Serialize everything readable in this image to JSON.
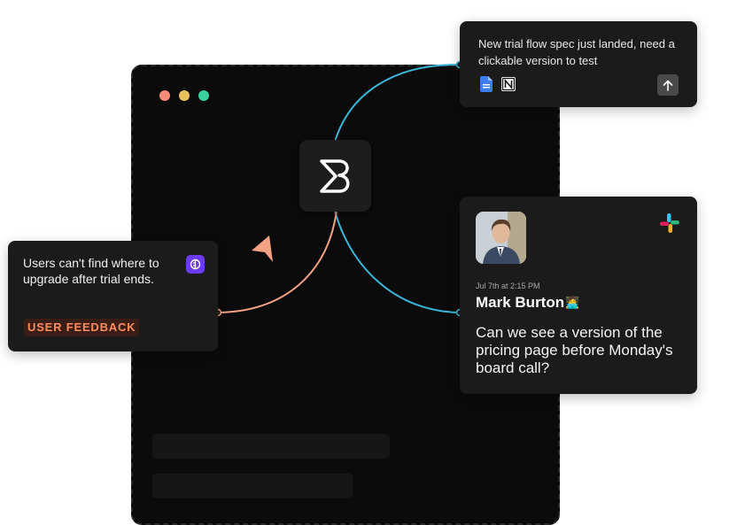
{
  "window": {
    "dot_colors": [
      "#f88b78",
      "#e8c25a",
      "#35d29f"
    ]
  },
  "icons": {
    "brand_logo": "stylized-b-logo-icon",
    "google_docs": "google-docs-icon",
    "notion": "notion-icon",
    "send": "arrow-up-icon",
    "feedback_tool": "feedback-app-icon",
    "slack": "slack-icon",
    "cursor": "cursor-arrow-icon",
    "emoji": "technologist-emoji-icon"
  },
  "top_card": {
    "message": "New trial flow spec just landed, need a clickable version to test"
  },
  "feedback_card": {
    "message": "Users can't find where to upgrade after trial ends.",
    "tag": "USER FEEDBACK"
  },
  "slack_card": {
    "timestamp": "Jul 7th at 2:15 PM",
    "author": "Mark Burton",
    "emoji": "🧑‍💻",
    "message": "Can we see a version of the pricing page before Monday's board call?"
  },
  "colors": {
    "connector_blue": "#3bb6d8",
    "connector_orange": "#f4a184",
    "tag_text": "#ff8d5c",
    "tag_bg": "#3a1d14",
    "feedback_icon_bg": "#6a3bf0",
    "cursor": "#f4a184"
  }
}
